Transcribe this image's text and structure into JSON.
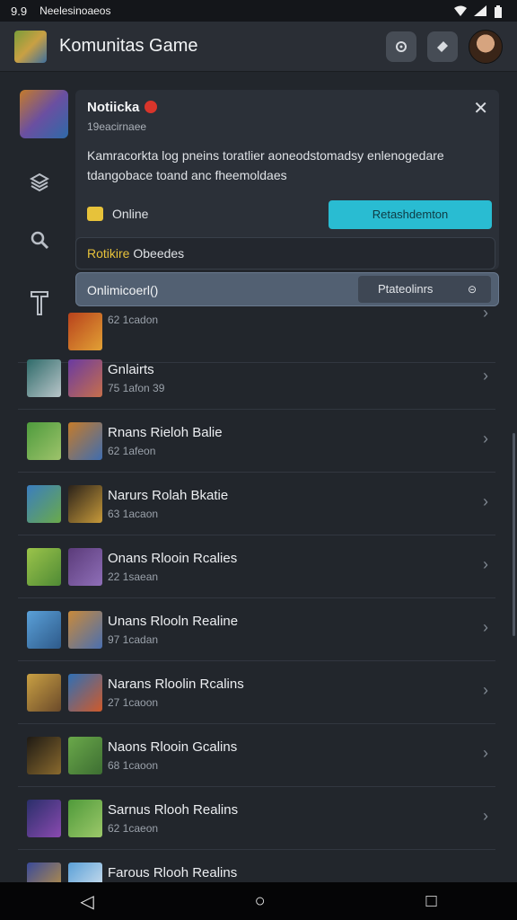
{
  "statusbar": {
    "time": "9.9",
    "notification_text": "Neelesinoaeos",
    "icons": [
      "wifi-icon",
      "signal-icon",
      "battery-icon"
    ]
  },
  "appbar": {
    "title": "Komunitas Game",
    "buttons": [
      "settings-icon",
      "chat-icon"
    ]
  },
  "notification": {
    "title": "Notiicka",
    "subtitle": "19eacirnaee",
    "message": "Kamracorkta log pneins toratlier aoneodstomadsy enlenogedare tdangobace toand anc fheemoldaes",
    "status_label": "Online",
    "action_label": "Retashdemton",
    "close_symbol": "✕",
    "accent_color": "#29bcd2"
  },
  "filter": {
    "highlight": "Rotikire",
    "text": " Obeedes"
  },
  "selected": {
    "label": "Onlimicoerl()",
    "button_label": "Ptateolinrs",
    "button_glyph": "⊝"
  },
  "list": [
    {
      "title": "",
      "meta": "62 1cadon"
    },
    {
      "title": "Gnlairts",
      "meta": "75 1afon 39"
    },
    {
      "title": "Rnans Rieloh Balie",
      "meta": "62 1afeon"
    },
    {
      "title": "Narurs Rolah Bkatie",
      "meta": "63 1acaon"
    },
    {
      "title": "Onans Rlooin Rcalies",
      "meta": "22 1saean"
    },
    {
      "title": "Unans Rlooln Realine",
      "meta": "97 1cadan"
    },
    {
      "title": "Narans Rloolin Rcalins",
      "meta": "27 1caoon"
    },
    {
      "title": "Naons Rlooin Gcalins",
      "meta": "68 1caoon"
    },
    {
      "title": "Sarnus Rlooh Realins",
      "meta": "62 1caeon"
    },
    {
      "title": "Farous Rlooh Realins",
      "meta": ""
    }
  ],
  "navbar": {
    "back": "◁",
    "home": "○",
    "recents": "□"
  }
}
